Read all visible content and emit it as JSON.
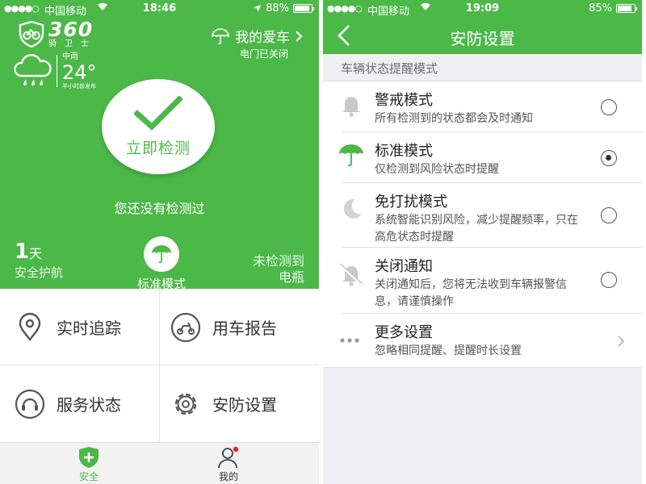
{
  "left": {
    "status": {
      "carrier": "中国移动",
      "time": "18:46",
      "battery": "88%",
      "battery_level": 0.88
    },
    "logo": {
      "number": "360",
      "sub": "骑卫士"
    },
    "car": {
      "title": "我的爱车",
      "status": "电门已关闭"
    },
    "weather": {
      "condition": "中雨",
      "temp": "24°",
      "published": "半小时前发布"
    },
    "check_button": "立即检测",
    "never_checked": "您还没有检测过",
    "stats": {
      "days_num": "1",
      "days_unit": "天",
      "days_caption": "安全护航",
      "mode_label": "标准模式",
      "battery_line1": "未检测到",
      "battery_line2": "电瓶"
    },
    "grid": {
      "tracking": "实时追踪",
      "report": "用车报告",
      "service": "服务状态",
      "security": "安防设置"
    },
    "tabs": {
      "safe": "安全",
      "mine": "我的"
    },
    "accent": "#4cb848"
  },
  "right": {
    "status": {
      "carrier": "中国移动",
      "time": "19:09",
      "battery": "85%",
      "battery_level": 0.85
    },
    "title": "安防设置",
    "section": "车辆状态提醒模式",
    "rows": [
      {
        "title": "警戒模式",
        "desc": "所有检测到的状态都会及时通知",
        "selected": false
      },
      {
        "title": "标准模式",
        "desc": "仅检测到风险状态时提醒",
        "selected": true
      },
      {
        "title": "免打扰模式",
        "desc": "系统智能识别风险，减少提醒频率，只在高危状态时提醒",
        "selected": false
      },
      {
        "title": "关闭通知",
        "desc": "关闭通知后，您将无法收到车辆报警信息，请谨慎操作",
        "selected": false
      },
      {
        "title": "更多设置",
        "desc": "忽略相同提醒、提醒时长设置"
      }
    ]
  }
}
